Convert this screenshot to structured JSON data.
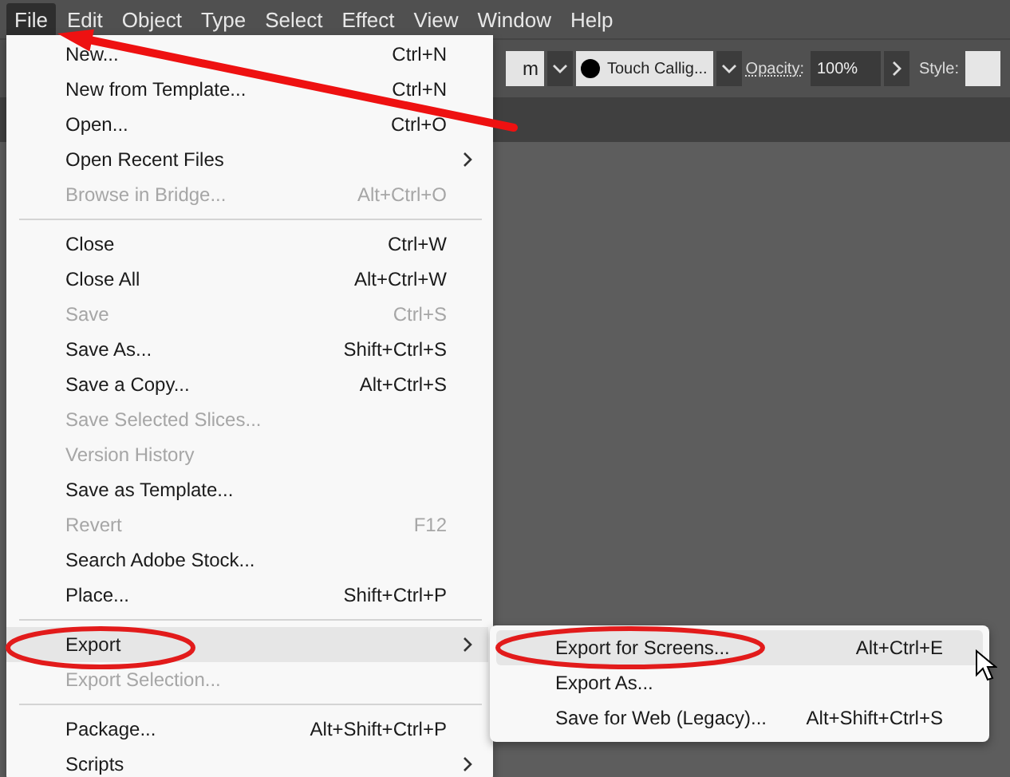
{
  "menubar": [
    {
      "label": "File",
      "selected": true
    },
    {
      "label": "Edit",
      "selected": false
    },
    {
      "label": "Object",
      "selected": false
    },
    {
      "label": "Type",
      "selected": false
    },
    {
      "label": "Select",
      "selected": false
    },
    {
      "label": "Effect",
      "selected": false
    },
    {
      "label": "View",
      "selected": false
    },
    {
      "label": "Window",
      "selected": false
    },
    {
      "label": "Help",
      "selected": false
    }
  ],
  "toolbar": {
    "field_value": "m",
    "brush": "Touch Callig...",
    "opacity_label": "Opacity:",
    "opacity_value": "100%",
    "style_label": "Style:"
  },
  "file_menu": [
    {
      "kind": "item",
      "label": "New...",
      "shortcut": "Ctrl+N",
      "disabled": false,
      "submenu": false,
      "selected": false
    },
    {
      "kind": "item",
      "label": "New from Template...",
      "shortcut": "Ctrl+N",
      "disabled": false,
      "submenu": false,
      "selected": false
    },
    {
      "kind": "item",
      "label": "Open...",
      "shortcut": "Ctrl+O",
      "disabled": false,
      "submenu": false,
      "selected": false
    },
    {
      "kind": "item",
      "label": "Open Recent Files",
      "disabled": false,
      "submenu": true,
      "selected": false
    },
    {
      "kind": "item",
      "label": "Browse in Bridge...",
      "shortcut": "Alt+Ctrl+O",
      "disabled": true,
      "submenu": false,
      "selected": false
    },
    {
      "kind": "separator"
    },
    {
      "kind": "item",
      "label": "Close",
      "shortcut": "Ctrl+W",
      "disabled": false,
      "submenu": false,
      "selected": false
    },
    {
      "kind": "item",
      "label": "Close All",
      "shortcut": "Alt+Ctrl+W",
      "disabled": false,
      "submenu": false,
      "selected": false
    },
    {
      "kind": "item",
      "label": "Save",
      "shortcut": "Ctrl+S",
      "disabled": true,
      "submenu": false,
      "selected": false
    },
    {
      "kind": "item",
      "label": "Save As...",
      "shortcut": "Shift+Ctrl+S",
      "disabled": false,
      "submenu": false,
      "selected": false
    },
    {
      "kind": "item",
      "label": "Save a Copy...",
      "shortcut": "Alt+Ctrl+S",
      "disabled": false,
      "submenu": false,
      "selected": false
    },
    {
      "kind": "item",
      "label": "Save Selected Slices...",
      "disabled": true,
      "submenu": false,
      "selected": false
    },
    {
      "kind": "item",
      "label": "Version History",
      "disabled": true,
      "submenu": false,
      "selected": false
    },
    {
      "kind": "item",
      "label": "Save as Template...",
      "disabled": false,
      "submenu": false,
      "selected": false
    },
    {
      "kind": "item",
      "label": "Revert",
      "shortcut": "F12",
      "disabled": true,
      "submenu": false,
      "selected": false
    },
    {
      "kind": "item",
      "label": "Search Adobe Stock...",
      "disabled": false,
      "submenu": false,
      "selected": false
    },
    {
      "kind": "item",
      "label": "Place...",
      "shortcut": "Shift+Ctrl+P",
      "disabled": false,
      "submenu": false,
      "selected": false
    },
    {
      "kind": "separator"
    },
    {
      "kind": "item",
      "label": "Export",
      "disabled": false,
      "submenu": true,
      "selected": true
    },
    {
      "kind": "item",
      "label": "Export Selection...",
      "disabled": true,
      "submenu": false,
      "selected": false
    },
    {
      "kind": "separator"
    },
    {
      "kind": "item",
      "label": "Package...",
      "shortcut": "Alt+Shift+Ctrl+P",
      "disabled": false,
      "submenu": false,
      "selected": false
    },
    {
      "kind": "item",
      "label": "Scripts",
      "disabled": false,
      "submenu": true,
      "selected": false
    }
  ],
  "export_submenu": [
    {
      "label": "Export for Screens...",
      "shortcut": "Alt+Ctrl+E",
      "selected": true
    },
    {
      "label": "Export As...",
      "selected": false
    },
    {
      "label": "Save for Web (Legacy)...",
      "shortcut": "Alt+Shift+Ctrl+S",
      "selected": false
    }
  ]
}
